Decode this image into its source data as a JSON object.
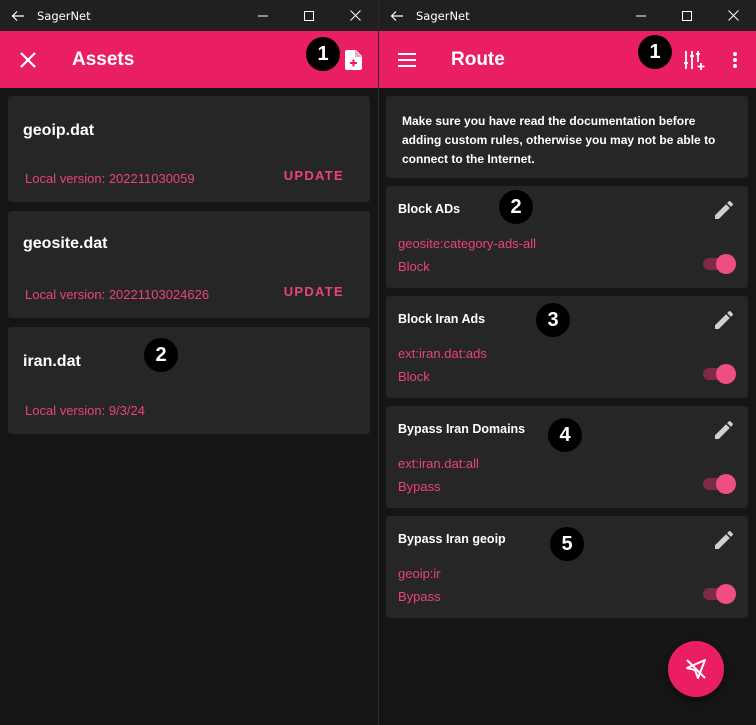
{
  "left": {
    "titlebar": {
      "title": "SagerNet"
    },
    "appbar": {
      "title": "Assets"
    },
    "assets": [
      {
        "name": "geoip.dat",
        "version": "Local version: 202211030059",
        "action": "UPDATE"
      },
      {
        "name": "geosite.dat",
        "version": "Local version: 20221103024626",
        "action": "UPDATE"
      },
      {
        "name": "iran.dat",
        "version": "Local version: 9/3/24",
        "action": ""
      }
    ],
    "badges": [
      "1",
      "2"
    ]
  },
  "right": {
    "titlebar": {
      "title": "SagerNet"
    },
    "appbar": {
      "title": "Route"
    },
    "notice": "Make sure you have read the documentation before adding custom rules, otherwise you may not be able to connect to the Internet.",
    "rules": [
      {
        "name": "Block ADs",
        "match": "geosite:category-ads-all",
        "action": "Block",
        "enabled": true
      },
      {
        "name": "Block Iran Ads",
        "match": "ext:iran.dat:ads",
        "action": "Block",
        "enabled": true
      },
      {
        "name": "Bypass Iran Domains",
        "match": "ext:iran.dat:all",
        "action": "Bypass",
        "enabled": true
      },
      {
        "name": "Bypass Iran geoip",
        "match": "geoip:ir",
        "action": "Bypass",
        "enabled": true
      }
    ],
    "badges": [
      "1",
      "2",
      "3",
      "4",
      "5"
    ]
  },
  "icons": {
    "back": "arrow-left-icon",
    "close": "close-icon",
    "add_file": "file-plus-icon",
    "menu": "hamburger-menu-icon",
    "add_rule": "tune-plus-icon",
    "more": "more-vertical-icon",
    "edit": "pencil-icon",
    "fab": "paper-plane-off-icon"
  },
  "colors": {
    "accent": "#e91e63",
    "accent_text": "#e8447a",
    "card": "#262626",
    "background": "#151515"
  }
}
